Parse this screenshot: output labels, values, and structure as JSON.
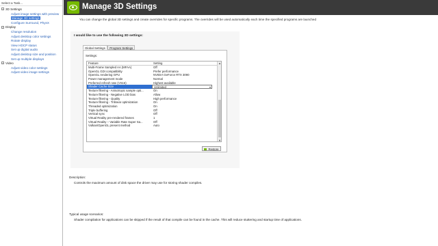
{
  "taskpane": {
    "title": "Select a Task...",
    "tree": [
      {
        "type": "category",
        "label": "3D Settings",
        "expander": "−"
      },
      {
        "type": "leaf",
        "label": "Adjust image settings with preview"
      },
      {
        "type": "leaf",
        "label": "Manage 3D settings",
        "selected": true
      },
      {
        "type": "leaf",
        "label": "Configure Surround, PhysX"
      },
      {
        "type": "category",
        "label": "Display",
        "expander": "−"
      },
      {
        "type": "leaf",
        "label": "Change resolution"
      },
      {
        "type": "leaf",
        "label": "Adjust desktop color settings"
      },
      {
        "type": "leaf",
        "label": "Rotate display"
      },
      {
        "type": "leaf",
        "label": "View HDCP status"
      },
      {
        "type": "leaf",
        "label": "Set up digital audio"
      },
      {
        "type": "leaf",
        "label": "Adjust desktop size and position"
      },
      {
        "type": "leaf",
        "label": "Set up multiple displays"
      },
      {
        "type": "category",
        "label": "Video",
        "expander": "−"
      },
      {
        "type": "leaf",
        "label": "Adjust video color settings"
      },
      {
        "type": "leaf",
        "label": "Adjust video image settings"
      }
    ]
  },
  "header": {
    "title": "Manage 3D Settings",
    "logo_icon": "nvidia-logo-icon"
  },
  "intro": "You can change the global 3D settings and create overrides for specific programs. The overrides will be used automatically each time the specified programs are launched",
  "panel": {
    "heading": "I would like to use the following 3D settings:",
    "tabs": [
      {
        "label": "Global Settings",
        "active": true
      },
      {
        "label": "Program Settings",
        "active": false
      }
    ],
    "settings_label": "Settings:",
    "columns": {
      "feature": "Feature",
      "setting": "Setting"
    },
    "rows": [
      {
        "feature": "Multi-Frame Sampled AA (MFAA)",
        "setting": "Off"
      },
      {
        "feature": "OpenGL GDI compatibility",
        "setting": "Prefer performance"
      },
      {
        "feature": "OpenGL rendering GPU",
        "setting": "NVIDIA GeForce RTX 3090"
      },
      {
        "feature": "Power management mode",
        "setting": "Normal"
      },
      {
        "feature": "Preferred refresh rate (VS16)",
        "setting": "Highest available"
      },
      {
        "feature": "Shader Cache Size",
        "setting": "Unlimited",
        "selected": true
      },
      {
        "feature": "Texture filtering - Anisotropic sample opti...",
        "setting": "On"
      },
      {
        "feature": "Texture filtering - Negative LOD bias",
        "setting": "Allow"
      },
      {
        "feature": "Texture filtering - Quality",
        "setting": "High performance"
      },
      {
        "feature": "Texture filtering - Trilinear optimization",
        "setting": "On"
      },
      {
        "feature": "Threaded optimization",
        "setting": "On"
      },
      {
        "feature": "Triple buffering",
        "setting": "Off"
      },
      {
        "feature": "Vertical sync",
        "setting": "Off"
      },
      {
        "feature": "Virtual Reality pre-rendered frames",
        "setting": "1"
      },
      {
        "feature": "Virtual Reality – Variable Rate Super Sa...",
        "setting": "Off"
      },
      {
        "feature": "Vulkan/OpenGL present method",
        "setting": "Auto"
      }
    ],
    "restore_label": "Restore"
  },
  "description": {
    "label": "Description:",
    "text": "Controls the maximum amount of disk space the driver may use for storing shader compiles."
  },
  "usage": {
    "label": "Typical usage scenarios:",
    "text": "Shader compilation for applications can be skipped if the result of that compile can be found in the cache. This will reduce stuttering and startup time of applications."
  },
  "colors": {
    "accent": "#76b900",
    "selection": "#2f6fd0",
    "header_bg": "#3a3a3a"
  }
}
